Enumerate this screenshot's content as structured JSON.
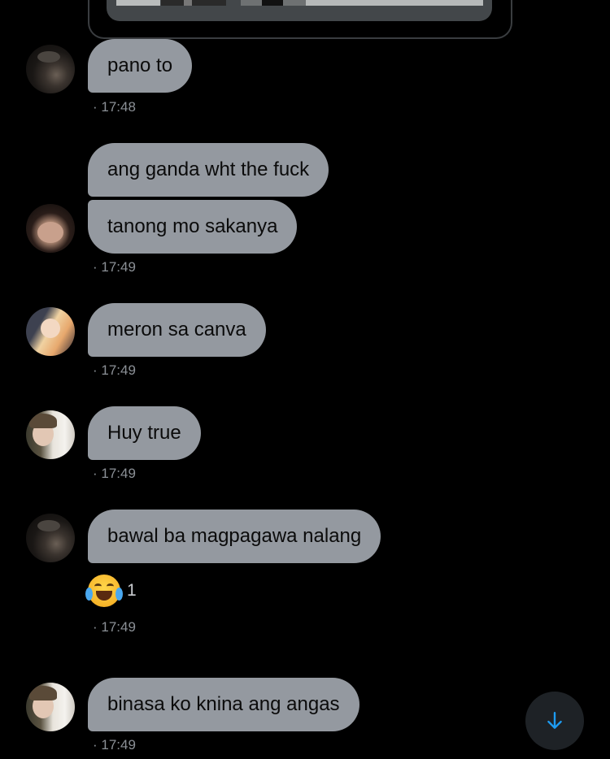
{
  "messages": [
    {
      "text": "pano to",
      "timestamp": "· 17:48"
    },
    {
      "text": "ang ganda wht the fuck"
    },
    {
      "text": "tanong mo sakanya",
      "timestamp": "· 17:49"
    },
    {
      "text": "meron sa canva",
      "timestamp": "· 17:49"
    },
    {
      "text": "Huy true",
      "timestamp": "· 17:49"
    },
    {
      "text": "bawal ba magpagawa nalang",
      "timestamp": "· 17:49",
      "reaction": {
        "emoji": "face-with-tears-of-joy-icon",
        "count": "1"
      }
    },
    {
      "text": "binasa ko knina ang angas",
      "timestamp": "· 17:49"
    }
  ],
  "scroll_button": {
    "icon": "arrow-down-icon",
    "accent_color": "#1d9bf0"
  },
  "colors": {
    "background": "#000000",
    "bubble": "#9499a0",
    "timestamp": "#8b9096"
  }
}
